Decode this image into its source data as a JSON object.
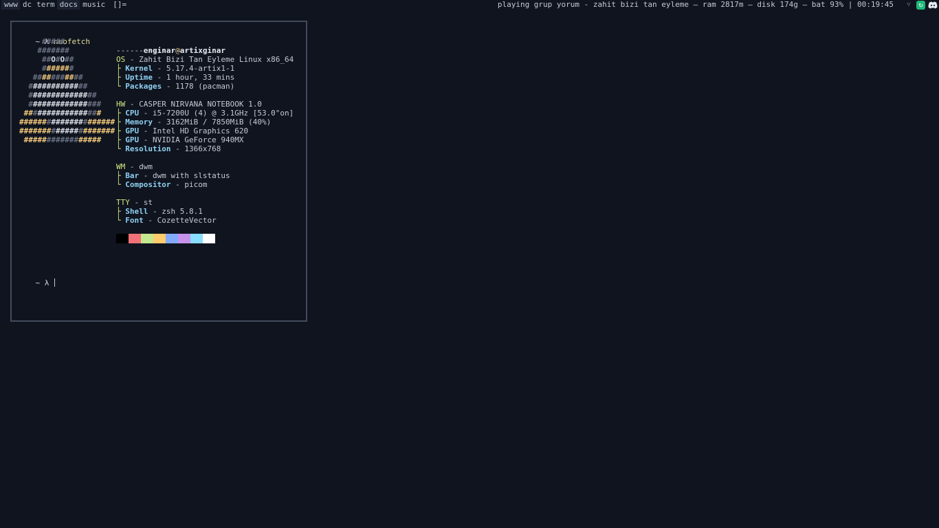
{
  "bar": {
    "tags": [
      {
        "label": "www",
        "occupied": true
      },
      {
        "label": "dc",
        "occupied": false
      },
      {
        "label": "term",
        "occupied": false
      },
      {
        "label": "docs",
        "occupied": true
      },
      {
        "label": "music",
        "occupied": false
      }
    ],
    "layout_symbol": "[]=",
    "status": "playing grup yorum - zahit bizi tan eyleme — ram 2817m — disk 174g — bat 93% | 00:19:45",
    "tray_icons": [
      "network-icon",
      "sync-icon",
      "discord-icon"
    ]
  },
  "terminal": {
    "prompt_symbol": "~ λ",
    "command": "neofetch",
    "final_prompt": "~ λ",
    "logo_lines": [
      [
        [
          "g",
          "#####"
        ]
      ],
      [
        [
          "g",
          "#######"
        ]
      ],
      [
        [
          "g",
          "##"
        ],
        [
          "w",
          "O"
        ],
        [
          "g",
          "#"
        ],
        [
          "w",
          "O"
        ],
        [
          "g",
          "##"
        ]
      ],
      [
        [
          "g",
          "#"
        ],
        [
          "y",
          "#####"
        ],
        [
          "g",
          "#"
        ]
      ],
      [
        [
          "g",
          "##"
        ],
        [
          "y",
          "##"
        ],
        [
          "g",
          "###"
        ],
        [
          "y",
          "##"
        ],
        [
          "g",
          "##"
        ]
      ],
      [
        [
          "g",
          "#"
        ],
        [
          "w",
          "##########"
        ],
        [
          "g",
          "##"
        ]
      ],
      [
        [
          "g",
          "#"
        ],
        [
          "w",
          "############"
        ],
        [
          "g",
          "##"
        ]
      ],
      [
        [
          "g",
          "#"
        ],
        [
          "w",
          "############"
        ],
        [
          "g",
          "###"
        ]
      ],
      [
        [
          "y",
          "##"
        ],
        [
          "g",
          "#"
        ],
        [
          "w",
          "###########"
        ],
        [
          "g",
          "##"
        ],
        [
          "y",
          "#"
        ]
      ],
      [
        [
          "y",
          "######"
        ],
        [
          "g",
          "#"
        ],
        [
          "w",
          "#######"
        ],
        [
          "g",
          "#"
        ],
        [
          "y",
          "######"
        ]
      ],
      [
        [
          "y",
          "#######"
        ],
        [
          "g",
          "#"
        ],
        [
          "w",
          "#####"
        ],
        [
          "g",
          "#"
        ],
        [
          "y",
          "#######"
        ]
      ],
      [
        [
          "y",
          "#####"
        ],
        [
          "g",
          "#######"
        ],
        [
          "y",
          "#####"
        ]
      ]
    ],
    "user": "enginar",
    "at": "@",
    "host": "artixginar",
    "separator": "------------------",
    "sections": [
      {
        "label": "OS",
        "value": "Zahit Bizi Tan Eyleme Linux x86_64",
        "items": [
          {
            "key": "Kernel",
            "value": "5.17.4-artix1-1"
          },
          {
            "key": "Uptime",
            "value": "1 hour, 33 mins"
          },
          {
            "key": "Packages",
            "value": "1178 (pacman)"
          }
        ]
      },
      {
        "label": "HW",
        "value": "CASPER NIRVANA NOTEBOOK 1.0",
        "items": [
          {
            "key": "CPU",
            "value": "i5-7200U (4) @ 3.1GHz [53.0°on]"
          },
          {
            "key": "Memory",
            "value": "3162MiB / 7850MiB (40%)"
          },
          {
            "key": "GPU",
            "value": "Intel HD Graphics 620"
          },
          {
            "key": "GPU",
            "value": "NVIDIA GeForce 940MX"
          },
          {
            "key": "Resolution",
            "value": "1366x768"
          }
        ]
      },
      {
        "label": "WM",
        "value": "dwm",
        "items": [
          {
            "key": "Bar",
            "value": "dwm with slstatus"
          },
          {
            "key": "Compositor",
            "value": "picom"
          }
        ]
      },
      {
        "label": "TTY",
        "value": "st",
        "items": [
          {
            "key": "Shell",
            "value": "zsh 5.8.1"
          },
          {
            "key": "Font",
            "value": "CozetteVector"
          }
        ]
      }
    ],
    "palette": [
      "#000000",
      "#f07178",
      "#c3e88d",
      "#ffcb6b",
      "#82aaff",
      "#c792ea",
      "#89ddff",
      "#ffffff"
    ]
  }
}
